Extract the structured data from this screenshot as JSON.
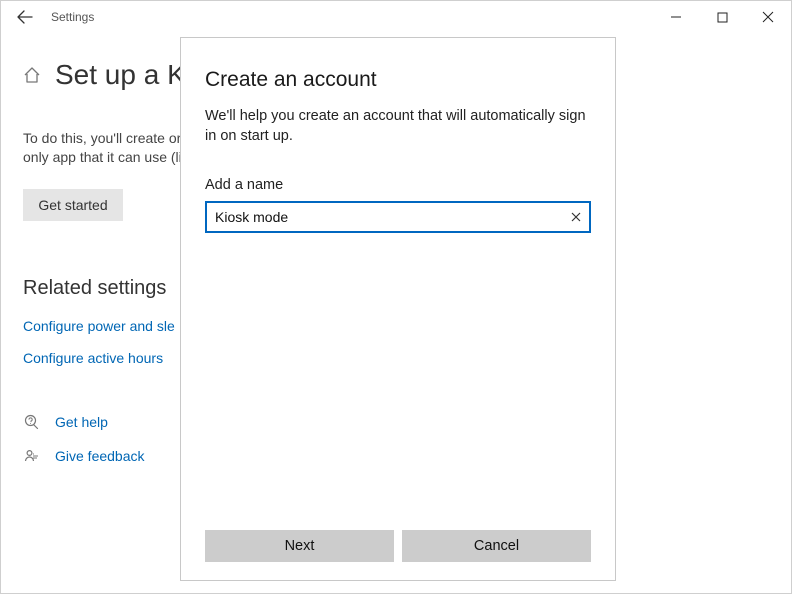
{
  "titlebar": {
    "title": "Settings"
  },
  "page": {
    "heading": "Set up a kiosk",
    "heading_truncated": "Set up a K",
    "intro_line1": "To do this, you'll create or choose an account and then choose the",
    "intro_line2": "only app that it can use (like a browser for a public terminal).",
    "get_started": "Get started"
  },
  "related": {
    "title": "Related settings",
    "link_power": "Configure power and sleep settings",
    "link_power_truncated": "Configure power and sle",
    "link_hours": "Configure active hours"
  },
  "help": {
    "get_help": "Get help",
    "give_feedback": "Give feedback"
  },
  "dialog": {
    "title": "Create an account",
    "desc": "We'll help you create an account that will automatically sign in on start up.",
    "field_label": "Add a name",
    "input_value": "Kiosk mode",
    "next": "Next",
    "cancel": "Cancel"
  }
}
